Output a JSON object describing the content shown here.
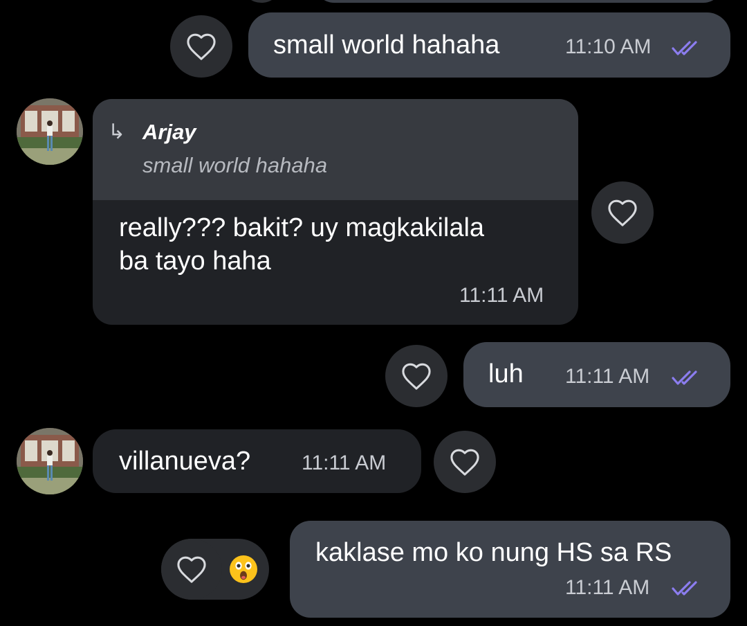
{
  "messages": {
    "m1": {
      "text": "small world hahaha",
      "time": "11:10 AM"
    },
    "m2": {
      "reply_to_name": "Arjay",
      "reply_to_text": "small world hahaha",
      "text_line1": "really??? bakit? uy magkakilala",
      "text_line2": "ba tayo haha",
      "time": "11:11 AM"
    },
    "m3": {
      "text": "luh",
      "time": "11:11 AM"
    },
    "m4": {
      "text": "villanueva?",
      "time": "11:11 AM"
    },
    "m5": {
      "text": "kaklase mo ko nung HS sa RS",
      "time": "11:11 AM",
      "reaction": "😲"
    }
  },
  "icons": {
    "heart": "heart-outline-icon",
    "read_receipt": "double-check-icon",
    "reply": "reply-arrow-icon"
  },
  "colors": {
    "background": "#000000",
    "outgoing_bubble": "#3e434c",
    "incoming_bubble": "#202226",
    "read_check": "#8c7df0"
  }
}
